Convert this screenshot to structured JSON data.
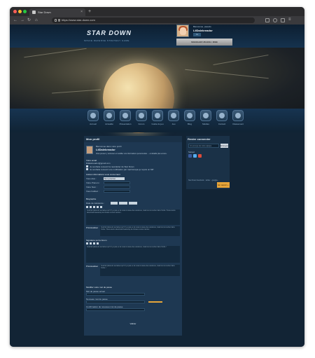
{
  "browser": {
    "tab_title": "Star Down",
    "tab_close": "×",
    "new_tab": "+",
    "url": "https://www.star-down.com",
    "nav_back": "←",
    "nav_forward": "→",
    "nav_reload": "↻",
    "nav_home": "⌂"
  },
  "header": {
    "logo_text": "STAR DOWN",
    "logo_subtitle": "SPACE DEFENSE STRATEGY GAME",
    "welcome": "Bienvenue, pseudo",
    "username": "LilDalekreador",
    "count_badge": "11",
    "report_button": "SIGNALER UN BUG / IDEE"
  },
  "nav": {
    "items": [
      {
        "label": "Accueil",
        "icon": "home-icon"
      },
      {
        "label": "Actualité",
        "icon": "news-icon"
      },
      {
        "label": "Présentation",
        "icon": "info-icon"
      },
      {
        "label": "Forum",
        "icon": "forum-icon"
      },
      {
        "label": "Guide du jeu",
        "icon": "guide-icon"
      },
      {
        "label": "Jeu",
        "icon": "game-icon"
      },
      {
        "label": "Blog",
        "icon": "blog-icon"
      },
      {
        "label": "Médias",
        "icon": "media-icon"
      },
      {
        "label": "Contact",
        "icon": "contact-icon"
      },
      {
        "label": "Classement",
        "icon": "ranking-icon"
      }
    ]
  },
  "profile": {
    "panel_title": "Mon profil",
    "intro_label": "Bienvenue dans votre profil",
    "username": "LilDalekreador",
    "intro_desc": "Vous pouvez y retrouver et modifier vos informations personnelles ... et détaillé plus encore.",
    "email_label": "Votre email",
    "email_value": "lildalekreador@gmail.com",
    "checkbox1": "Je souhaite recevoir la newsletter de Star Down",
    "checkbox2": "Je souhaite recevoir une notification par mail lorsque je reçois un MP",
    "section_personal": "Autres informations vous concernant",
    "sex_label": "Vous êtes :",
    "sex_value": "Non précisé",
    "firstname_label": "Votre Prénom :",
    "lastname_label": "Votre Nom :",
    "city_label": "Vous habitez :",
    "section_bio": "Biographie",
    "birthdate_label": "Date de naissance :",
    "bio_text": "Cela fait plusieurs semaines qu'il n'y a pas eu de news à cause des vacances, mais tout va rentrer dans l'ordre ! Nous avons désormais beaucoup de choses à vous montrer...",
    "preview_label": "Prévisualiser",
    "section_signature": "Signature sur le forum",
    "signature_text": "Cela fait plusieurs semaines qu'il n'y a pas eu de news à cause des vacances, mais tout va rentrer dans l'ordre !",
    "section_password": "Modifier votre mot de passe",
    "old_password_label": "Mot de passe actuel",
    "new_password_label": "Nouveau mot de passe",
    "confirm_password_label": "Confirmation du nouveau mot de passe",
    "submit": "Valider"
  },
  "sidebar": {
    "title": "Rester connecter",
    "search_placeholder": "Un envoyé de notre équipe",
    "search_button": "Envoyer",
    "follow_label": "Suivez",
    "links_text": "Star Down facebook · twitter · google+",
    "orange_button": "En savoir +"
  }
}
